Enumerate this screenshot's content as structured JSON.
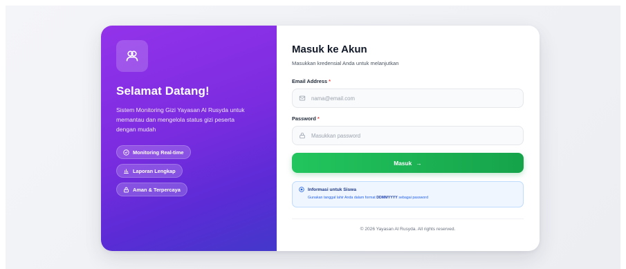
{
  "left_panel": {
    "logo_icon": "users-icon",
    "title": "Selamat Datang!",
    "description": "Sistem Monitoring Gizi Yayasan Al Rusyda untuk memantau dan mengelola status gizi peserta dengan mudah",
    "badges": [
      {
        "label": "Monitoring Real-time",
        "icon": "check-circle-icon"
      },
      {
        "label": "Laporan Lengkap",
        "icon": "bar-chart-icon"
      },
      {
        "label": "Aman & Terpercaya",
        "icon": "lock-icon"
      }
    ],
    "gradient_colors": [
      "#9333ea",
      "#4338ca"
    ]
  },
  "login_form": {
    "title": "Masuk ke Akun",
    "subtitle": "Masukkan kredensial Anda untuk melanjutkan",
    "email": {
      "label": "Email Address",
      "required_mark": "*",
      "placeholder": "nama@email.com",
      "value": "",
      "icon": "mail-icon"
    },
    "password": {
      "label": "Password",
      "required_mark": "*",
      "placeholder": "Masukkan password",
      "value": "",
      "icon": "lock-icon"
    },
    "submit_label": "Masuk",
    "submit_arrow": "→",
    "submit_color": "#16a34a"
  },
  "info_box": {
    "icon": "info-icon",
    "title": "Informasi untuk Siswa",
    "text_before": "Gunakan tanggal lahir Anda dalam format ",
    "text_bold": "DDMMYYYY",
    "text_after": " sebagai password"
  },
  "footer": {
    "text": "© 2026 Yayasan Al Rusyda. All rights reserved."
  }
}
